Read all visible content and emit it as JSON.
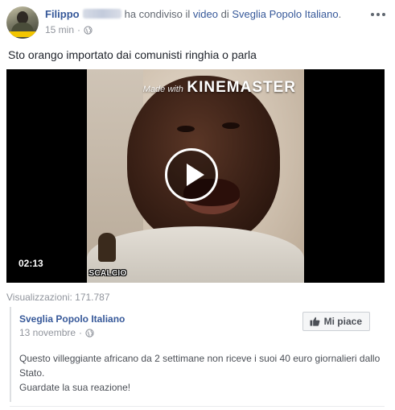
{
  "post": {
    "author_first_name": "Filippo",
    "shared_verb": "ha condiviso il",
    "shared_object_link": "video",
    "preposition": "di",
    "shared_page_link": "Sveglia Popolo Italiano",
    "trailing_punct": ".",
    "time_ago": "15 min",
    "separator": "·",
    "privacy_icon": "globe-icon",
    "more_icon": "more-options-icon",
    "text": "Sto orango importato dai comunisti ringhia o parla"
  },
  "video": {
    "watermark_prefix": "Made with",
    "watermark_brand": "KINEMASTER",
    "logo_text": "SCALCIO",
    "duration": "02:13",
    "play_icon": "play-icon"
  },
  "views": {
    "label": "Visualizzazioni: 171.787"
  },
  "shared": {
    "page_name": "Sveglia Popolo Italiano",
    "date": "13 novembre",
    "separator": "·",
    "like_button_label": "Mi piace",
    "text_lines": [
      "Questo villeggiante africano da 2 settimane non riceve i suoi 40 euro giornalieri dallo",
      "Stato.",
      "Guardate la sua reazione!"
    ]
  },
  "colors": {
    "link_blue": "#365899",
    "meta_gray": "#90949c",
    "text_dark": "#1d2129",
    "video_bg": "#000000"
  }
}
